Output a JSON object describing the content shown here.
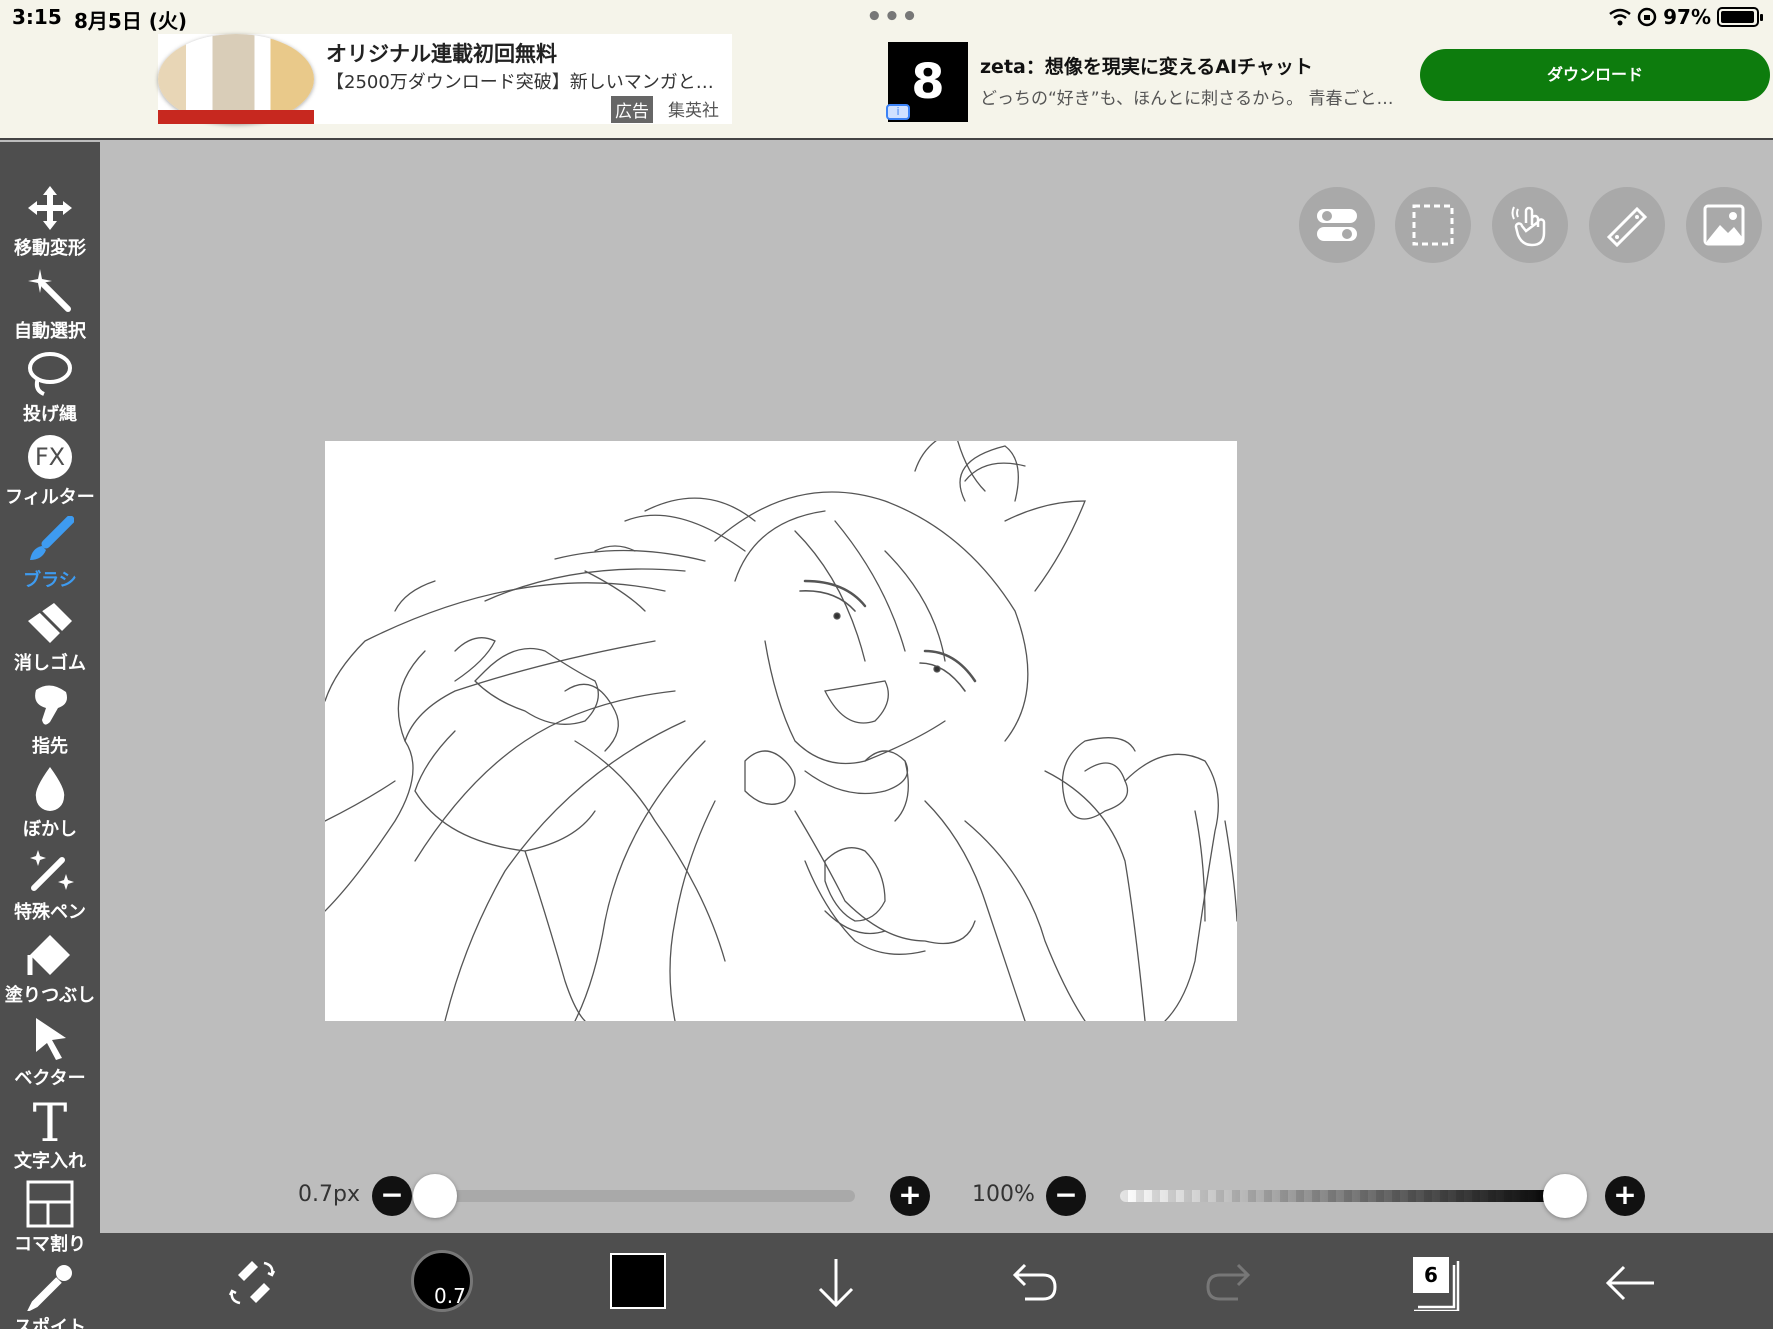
{
  "status_bar": {
    "time": "3:15",
    "date": "8月5日 (火)",
    "battery_percent": "97%",
    "battery_level": 0.97
  },
  "ads": {
    "ad1": {
      "title": "オリジナル連載初回無料",
      "description": "【2500万ダウンロード突破】新しいマンガと…",
      "tag": "広告",
      "publisher": "集英社"
    },
    "ad2": {
      "title": "zeta：想像を現実に変えるAIチャット",
      "description": "どっちの“好き”も、ほんとに刺さるから。 青春ごと…",
      "cta": "ダウンロード",
      "logo_glyph": "8"
    }
  },
  "toolbar": {
    "active_color": "#3e9bf0",
    "items": [
      {
        "label": "移動変形",
        "icon": "move-arrows-icon"
      },
      {
        "label": "自動選択",
        "icon": "magic-wand-icon"
      },
      {
        "label": "投げ縄",
        "icon": "lasso-icon"
      },
      {
        "label": "フィルター",
        "icon": "fx-icon",
        "glyph": "FX"
      },
      {
        "label": "ブラシ",
        "icon": "brush-icon"
      },
      {
        "label": "消しゴム",
        "icon": "eraser-icon"
      },
      {
        "label": "指先",
        "icon": "finger-smudge-icon"
      },
      {
        "label": "ぼかし",
        "icon": "blur-drop-icon"
      },
      {
        "label": "特殊ペン",
        "icon": "special-pen-icon"
      },
      {
        "label": "塗りつぶし",
        "icon": "fill-bucket-icon"
      },
      {
        "label": "ベクター",
        "icon": "vector-cursor-icon"
      },
      {
        "label": "文字入れ",
        "icon": "text-icon",
        "glyph": "T"
      },
      {
        "label": "コマ割り",
        "icon": "frame-divider-icon"
      },
      {
        "label": "スポイト",
        "icon": "eyedropper-icon"
      }
    ]
  },
  "sliders": {
    "brush_size": {
      "label": "0.7px",
      "level": 0.0
    },
    "opacity": {
      "label": "100%",
      "level": 1.0
    }
  },
  "bottom_bar": {
    "brush_size_value": "0.7",
    "current_color": "#000000",
    "layer_count": "6"
  }
}
